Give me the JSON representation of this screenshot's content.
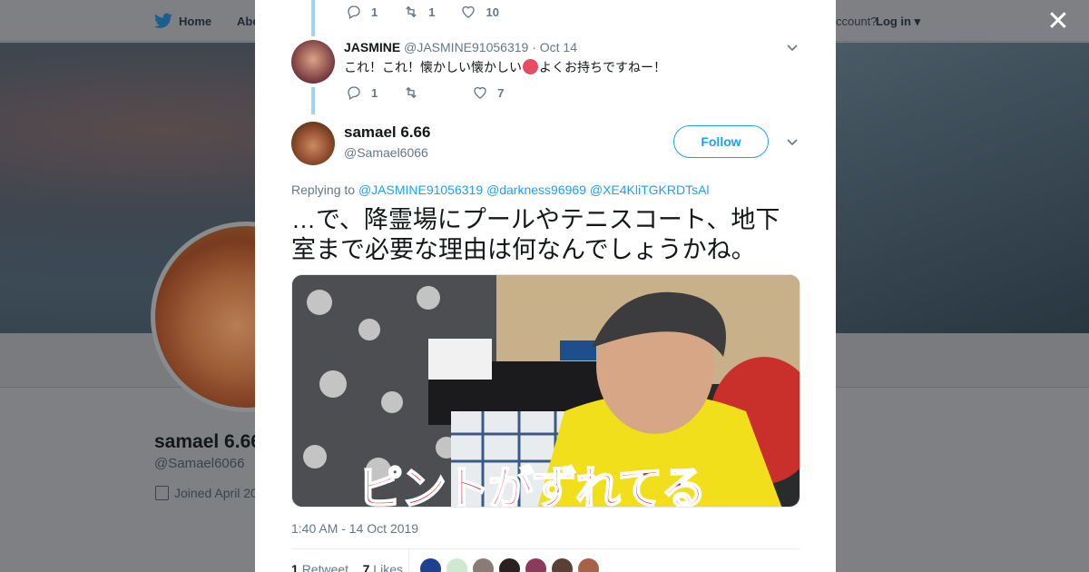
{
  "background": {
    "nav": {
      "home": "Home",
      "about": "Abo"
    },
    "account_text": "ccount?",
    "login": "Log in",
    "profile_name": "samael 6.66",
    "profile_handle": "@Samael6066",
    "joined": "Joined April 20"
  },
  "modal": {
    "prev_tweet_actions": {
      "replies": "1",
      "retweets": "1",
      "likes": "10"
    },
    "reply_tweet": {
      "name": "JASMINE",
      "handle": "@JASMINE91056319",
      "date": "Oct 14",
      "text_before_emoji": "これ！これ！懐かしい懐かしい",
      "text_after_emoji": "よくお持ちですねー！",
      "actions": {
        "replies": "1",
        "retweets": "",
        "likes": "7"
      }
    },
    "main_tweet": {
      "name": "samael 6.66",
      "handle": "@Samael6066",
      "follow_label": "Follow",
      "replying_to_label": "Replying to",
      "mentions": [
        "@JASMINE91056319",
        "@darkness96969",
        "@XE4KliTGKRDTsAl"
      ],
      "text_line1": "…で、降霊場にプールやテニスコート、地下",
      "text_line2": "室まで必要な理由は何なんでしょうかね。",
      "image_caption": "ピントがずれてる",
      "timestamp": "1:40 AM - 14 Oct 2019",
      "retweet_count": "1",
      "retweet_label": "Retweet",
      "like_count": "7",
      "like_label": "Likes"
    }
  },
  "icons": {
    "close": "close-icon",
    "reply": "reply-icon",
    "retweet": "retweet-icon",
    "like": "heart-icon",
    "caret": "chevron-down-icon"
  },
  "colors": {
    "accent": "#1da1f2",
    "thread_line": "#a2d2f3",
    "caption_red": "#e4151f"
  }
}
